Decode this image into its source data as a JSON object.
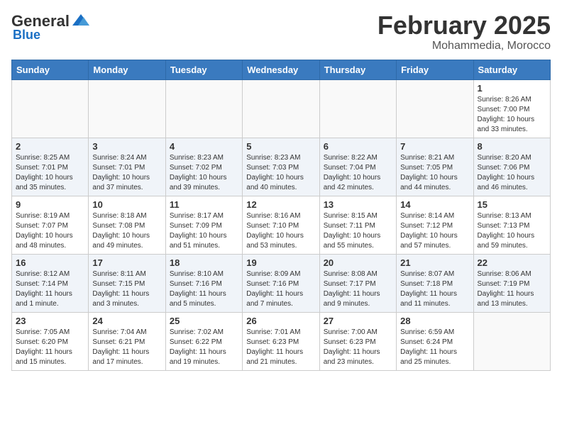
{
  "header": {
    "logo_general": "General",
    "logo_blue": "Blue",
    "month_title": "February 2025",
    "location": "Mohammedia, Morocco"
  },
  "weekdays": [
    "Sunday",
    "Monday",
    "Tuesday",
    "Wednesday",
    "Thursday",
    "Friday",
    "Saturday"
  ],
  "weeks": [
    {
      "row_style": "normal-row",
      "days": [
        {
          "num": "",
          "empty": true
        },
        {
          "num": "",
          "empty": true
        },
        {
          "num": "",
          "empty": true
        },
        {
          "num": "",
          "empty": true
        },
        {
          "num": "",
          "empty": true
        },
        {
          "num": "",
          "empty": true
        },
        {
          "num": "1",
          "sunrise": "8:26 AM",
          "sunset": "7:00 PM",
          "daylight": "10 hours and 33 minutes."
        }
      ]
    },
    {
      "row_style": "alt-row",
      "days": [
        {
          "num": "2",
          "sunrise": "8:25 AM",
          "sunset": "7:01 PM",
          "daylight": "10 hours and 35 minutes."
        },
        {
          "num": "3",
          "sunrise": "8:24 AM",
          "sunset": "7:01 PM",
          "daylight": "10 hours and 37 minutes."
        },
        {
          "num": "4",
          "sunrise": "8:23 AM",
          "sunset": "7:02 PM",
          "daylight": "10 hours and 39 minutes."
        },
        {
          "num": "5",
          "sunrise": "8:23 AM",
          "sunset": "7:03 PM",
          "daylight": "10 hours and 40 minutes."
        },
        {
          "num": "6",
          "sunrise": "8:22 AM",
          "sunset": "7:04 PM",
          "daylight": "10 hours and 42 minutes."
        },
        {
          "num": "7",
          "sunrise": "8:21 AM",
          "sunset": "7:05 PM",
          "daylight": "10 hours and 44 minutes."
        },
        {
          "num": "8",
          "sunrise": "8:20 AM",
          "sunset": "7:06 PM",
          "daylight": "10 hours and 46 minutes."
        }
      ]
    },
    {
      "row_style": "normal-row",
      "days": [
        {
          "num": "9",
          "sunrise": "8:19 AM",
          "sunset": "7:07 PM",
          "daylight": "10 hours and 48 minutes."
        },
        {
          "num": "10",
          "sunrise": "8:18 AM",
          "sunset": "7:08 PM",
          "daylight": "10 hours and 49 minutes."
        },
        {
          "num": "11",
          "sunrise": "8:17 AM",
          "sunset": "7:09 PM",
          "daylight": "10 hours and 51 minutes."
        },
        {
          "num": "12",
          "sunrise": "8:16 AM",
          "sunset": "7:10 PM",
          "daylight": "10 hours and 53 minutes."
        },
        {
          "num": "13",
          "sunrise": "8:15 AM",
          "sunset": "7:11 PM",
          "daylight": "10 hours and 55 minutes."
        },
        {
          "num": "14",
          "sunrise": "8:14 AM",
          "sunset": "7:12 PM",
          "daylight": "10 hours and 57 minutes."
        },
        {
          "num": "15",
          "sunrise": "8:13 AM",
          "sunset": "7:13 PM",
          "daylight": "10 hours and 59 minutes."
        }
      ]
    },
    {
      "row_style": "alt-row",
      "days": [
        {
          "num": "16",
          "sunrise": "8:12 AM",
          "sunset": "7:14 PM",
          "daylight": "11 hours and 1 minute."
        },
        {
          "num": "17",
          "sunrise": "8:11 AM",
          "sunset": "7:15 PM",
          "daylight": "11 hours and 3 minutes."
        },
        {
          "num": "18",
          "sunrise": "8:10 AM",
          "sunset": "7:16 PM",
          "daylight": "11 hours and 5 minutes."
        },
        {
          "num": "19",
          "sunrise": "8:09 AM",
          "sunset": "7:16 PM",
          "daylight": "11 hours and 7 minutes."
        },
        {
          "num": "20",
          "sunrise": "8:08 AM",
          "sunset": "7:17 PM",
          "daylight": "11 hours and 9 minutes."
        },
        {
          "num": "21",
          "sunrise": "8:07 AM",
          "sunset": "7:18 PM",
          "daylight": "11 hours and 11 minutes."
        },
        {
          "num": "22",
          "sunrise": "8:06 AM",
          "sunset": "7:19 PM",
          "daylight": "11 hours and 13 minutes."
        }
      ]
    },
    {
      "row_style": "normal-row",
      "days": [
        {
          "num": "23",
          "sunrise": "7:05 AM",
          "sunset": "6:20 PM",
          "daylight": "11 hours and 15 minutes."
        },
        {
          "num": "24",
          "sunrise": "7:04 AM",
          "sunset": "6:21 PM",
          "daylight": "11 hours and 17 minutes."
        },
        {
          "num": "25",
          "sunrise": "7:02 AM",
          "sunset": "6:22 PM",
          "daylight": "11 hours and 19 minutes."
        },
        {
          "num": "26",
          "sunrise": "7:01 AM",
          "sunset": "6:23 PM",
          "daylight": "11 hours and 21 minutes."
        },
        {
          "num": "27",
          "sunrise": "7:00 AM",
          "sunset": "6:23 PM",
          "daylight": "11 hours and 23 minutes."
        },
        {
          "num": "28",
          "sunrise": "6:59 AM",
          "sunset": "6:24 PM",
          "daylight": "11 hours and 25 minutes."
        },
        {
          "num": "",
          "empty": true
        }
      ]
    }
  ]
}
